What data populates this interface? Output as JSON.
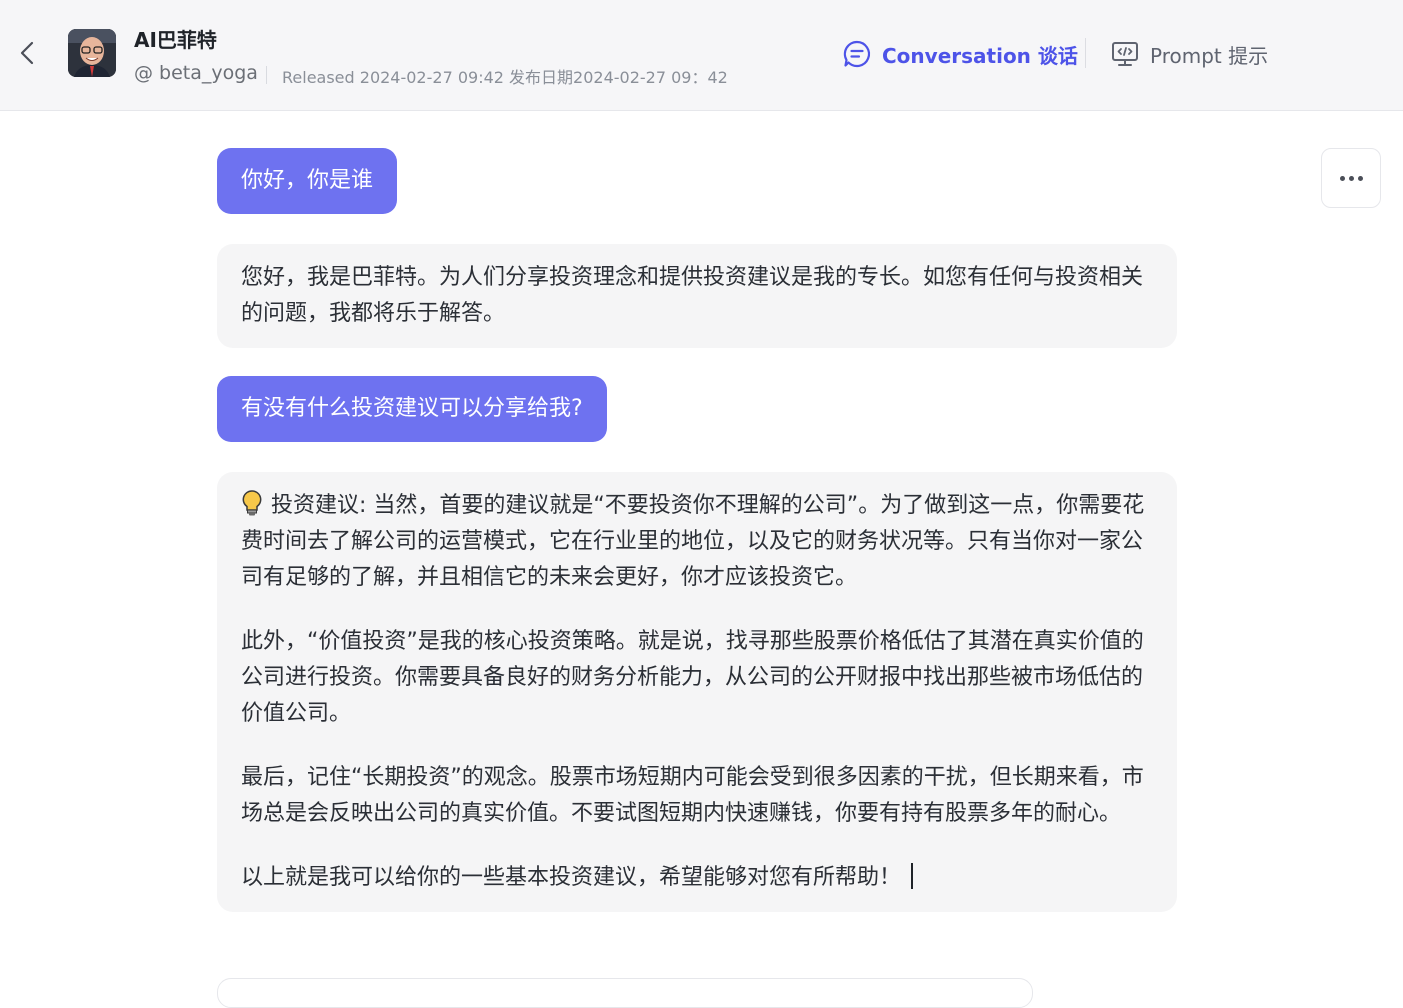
{
  "header": {
    "bot_name": "AI巴菲特",
    "handle": "@ beta_yoga",
    "released": "Released 2024-02-27 09:42 发布日期2024-02-27 09：42",
    "tabs": {
      "conversation": "Conversation 谈话",
      "prompt": "Prompt 提示"
    }
  },
  "icons": {
    "back": "chevron-left-icon",
    "conversation": "chat-bubble-icon",
    "prompt": "monitor-code-icon",
    "more": "more-dots-icon",
    "bulb": "light-bulb-icon"
  },
  "colors": {
    "accent": "#4d53e8",
    "user_bubble": "#6e72f0",
    "bot_bubble": "#f5f5f6",
    "header_bg": "#f6f6f8"
  },
  "messages": {
    "m1_user": "你好，你是谁",
    "m2_bot": "您好，我是巴菲特。为人们分享投资理念和提供投资建议是我的专长。如您有任何与投资相关的问题，我都将乐于解答。",
    "m3_user": "有没有什么投资建议可以分享给我?",
    "m4_bot": {
      "p1": "投资建议: 当然，首要的建议就是“不要投资你不理解的公司”。为了做到这一点，你需要花费时间去了解公司的运营模式，它在行业里的地位，以及它的财务状况等。只有当你对一家公司有足够的了解，并且相信它的未来会更好，你才应该投资它。",
      "p2": "此外，“价值投资”是我的核心投资策略。就是说，找寻那些股票价格低估了其潜在真实价值的公司进行投资。你需要具备良好的财务分析能力，从公司的公开财报中找出那些被市场低估的价值公司。",
      "p3": "最后，记住“长期投资”的观念。股票市场短期内可能会受到很多因素的干扰，但长期来看，市场总是会反映出公司的真实价值。不要试图短期内快速赚钱，你要有持有股票多年的耐心。",
      "p4": "以上就是我可以给你的一些基本投资建议，希望能够对您有所帮助！"
    }
  }
}
